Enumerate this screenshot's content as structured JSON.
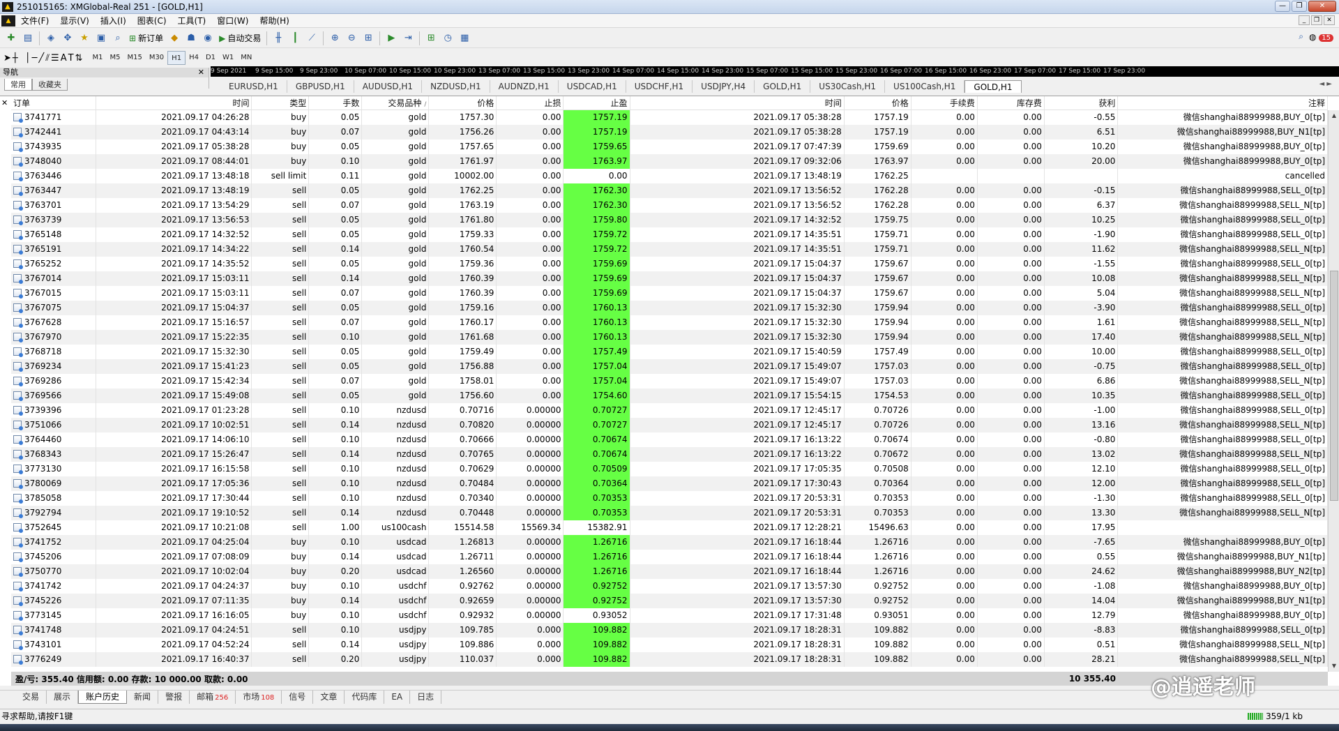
{
  "window": {
    "title": "251015165: XMGlobal-Real 251 - [GOLD,H1]"
  },
  "menu": [
    "文件(F)",
    "显示(V)",
    "插入(I)",
    "图表(C)",
    "工具(T)",
    "窗口(W)",
    "帮助(H)"
  ],
  "toolbar": {
    "new_order": "新订单",
    "auto_trade": "自动交易",
    "timeframes": [
      "M1",
      "M5",
      "M15",
      "M30",
      "H1",
      "H4",
      "D1",
      "W1",
      "MN"
    ],
    "notification_count": "15"
  },
  "navigator": {
    "title": "导航",
    "tabs": [
      "常用",
      "收藏夹"
    ]
  },
  "chart_axis": [
    "9 Sep 2021",
    "9 Sep 15:00",
    "9 Sep 23:00",
    "10 Sep 07:00",
    "10 Sep 15:00",
    "10 Sep 23:00",
    "13 Sep 07:00",
    "13 Sep 15:00",
    "13 Sep 23:00",
    "14 Sep 07:00",
    "14 Sep 15:00",
    "14 Sep 23:00",
    "15 Sep 07:00",
    "15 Sep 15:00",
    "15 Sep 23:00",
    "16 Sep 07:00",
    "16 Sep 15:00",
    "16 Sep 23:00",
    "17 Sep 07:00",
    "17 Sep 15:00",
    "17 Sep 23:00"
  ],
  "chart_tabs": [
    "EURUSD,H1",
    "GBPUSD,H1",
    "AUDUSD,H1",
    "NZDUSD,H1",
    "AUDNZD,H1",
    "USDCAD,H1",
    "USDCHF,H1",
    "USDJPY,H4",
    "GOLD,H1",
    "US30Cash,H1",
    "US100Cash,H1",
    "GOLD,H1"
  ],
  "columns": [
    "订单",
    "时间",
    "类型",
    "手数",
    "交易品种",
    "价格",
    "止损",
    "止盈",
    "时间",
    "价格",
    "手续费",
    "库存费",
    "获利",
    "注释"
  ],
  "rows": [
    [
      "3741771",
      "2021.09.17 04:26:28",
      "buy",
      "0.05",
      "gold",
      "1757.30",
      "0.00",
      "1757.19",
      "2021.09.17 05:38:28",
      "1757.19",
      "0.00",
      "0.00",
      "-0.55",
      "微信shanghai88999988,BUY_0[tp]",
      "g"
    ],
    [
      "3742441",
      "2021.09.17 04:43:14",
      "buy",
      "0.07",
      "gold",
      "1756.26",
      "0.00",
      "1757.19",
      "2021.09.17 05:38:28",
      "1757.19",
      "0.00",
      "0.00",
      "6.51",
      "微信shanghai88999988,BUY_N1[tp]",
      "g"
    ],
    [
      "3743935",
      "2021.09.17 05:38:28",
      "buy",
      "0.05",
      "gold",
      "1757.65",
      "0.00",
      "1759.65",
      "2021.09.17 07:47:39",
      "1759.69",
      "0.00",
      "0.00",
      "10.20",
      "微信shanghai88999988,BUY_0[tp]",
      "g"
    ],
    [
      "3748040",
      "2021.09.17 08:44:01",
      "buy",
      "0.10",
      "gold",
      "1761.97",
      "0.00",
      "1763.97",
      "2021.09.17 09:32:06",
      "1763.97",
      "0.00",
      "0.00",
      "20.00",
      "微信shanghai88999988,BUY_0[tp]",
      "g"
    ],
    [
      "3763446",
      "2021.09.17 13:48:18",
      "sell limit",
      "0.11",
      "gold",
      "10002.00",
      "0.00",
      "0.00",
      "2021.09.17 13:48:19",
      "1762.25",
      "",
      "",
      "",
      "cancelled",
      ""
    ],
    [
      "3763447",
      "2021.09.17 13:48:19",
      "sell",
      "0.05",
      "gold",
      "1762.25",
      "0.00",
      "1762.30",
      "2021.09.17 13:56:52",
      "1762.28",
      "0.00",
      "0.00",
      "-0.15",
      "微信shanghai88999988,SELL_0[tp]",
      "g"
    ],
    [
      "3763701",
      "2021.09.17 13:54:29",
      "sell",
      "0.07",
      "gold",
      "1763.19",
      "0.00",
      "1762.30",
      "2021.09.17 13:56:52",
      "1762.28",
      "0.00",
      "0.00",
      "6.37",
      "微信shanghai88999988,SELL_N[tp]",
      "g"
    ],
    [
      "3763739",
      "2021.09.17 13:56:53",
      "sell",
      "0.05",
      "gold",
      "1761.80",
      "0.00",
      "1759.80",
      "2021.09.17 14:32:52",
      "1759.75",
      "0.00",
      "0.00",
      "10.25",
      "微信shanghai88999988,SELL_0[tp]",
      "g"
    ],
    [
      "3765148",
      "2021.09.17 14:32:52",
      "sell",
      "0.05",
      "gold",
      "1759.33",
      "0.00",
      "1759.72",
      "2021.09.17 14:35:51",
      "1759.71",
      "0.00",
      "0.00",
      "-1.90",
      "微信shanghai88999988,SELL_0[tp]",
      "g"
    ],
    [
      "3765191",
      "2021.09.17 14:34:22",
      "sell",
      "0.14",
      "gold",
      "1760.54",
      "0.00",
      "1759.72",
      "2021.09.17 14:35:51",
      "1759.71",
      "0.00",
      "0.00",
      "11.62",
      "微信shanghai88999988,SELL_N[tp]",
      "g"
    ],
    [
      "3765252",
      "2021.09.17 14:35:52",
      "sell",
      "0.05",
      "gold",
      "1759.36",
      "0.00",
      "1759.69",
      "2021.09.17 15:04:37",
      "1759.67",
      "0.00",
      "0.00",
      "-1.55",
      "微信shanghai88999988,SELL_0[tp]",
      "g"
    ],
    [
      "3767014",
      "2021.09.17 15:03:11",
      "sell",
      "0.14",
      "gold",
      "1760.39",
      "0.00",
      "1759.69",
      "2021.09.17 15:04:37",
      "1759.67",
      "0.00",
      "0.00",
      "10.08",
      "微信shanghai88999988,SELL_N[tp]",
      "g"
    ],
    [
      "3767015",
      "2021.09.17 15:03:11",
      "sell",
      "0.07",
      "gold",
      "1760.39",
      "0.00",
      "1759.69",
      "2021.09.17 15:04:37",
      "1759.67",
      "0.00",
      "0.00",
      "5.04",
      "微信shanghai88999988,SELL_N[tp]",
      "g"
    ],
    [
      "3767075",
      "2021.09.17 15:04:37",
      "sell",
      "0.05",
      "gold",
      "1759.16",
      "0.00",
      "1760.13",
      "2021.09.17 15:32:30",
      "1759.94",
      "0.00",
      "0.00",
      "-3.90",
      "微信shanghai88999988,SELL_0[tp]",
      "g"
    ],
    [
      "3767628",
      "2021.09.17 15:16:57",
      "sell",
      "0.07",
      "gold",
      "1760.17",
      "0.00",
      "1760.13",
      "2021.09.17 15:32:30",
      "1759.94",
      "0.00",
      "0.00",
      "1.61",
      "微信shanghai88999988,SELL_N[tp]",
      "g"
    ],
    [
      "3767970",
      "2021.09.17 15:22:35",
      "sell",
      "0.10",
      "gold",
      "1761.68",
      "0.00",
      "1760.13",
      "2021.09.17 15:32:30",
      "1759.94",
      "0.00",
      "0.00",
      "17.40",
      "微信shanghai88999988,SELL_N[tp]",
      "g"
    ],
    [
      "3768718",
      "2021.09.17 15:32:30",
      "sell",
      "0.05",
      "gold",
      "1759.49",
      "0.00",
      "1757.49",
      "2021.09.17 15:40:59",
      "1757.49",
      "0.00",
      "0.00",
      "10.00",
      "微信shanghai88999988,SELL_0[tp]",
      "g"
    ],
    [
      "3769234",
      "2021.09.17 15:41:23",
      "sell",
      "0.05",
      "gold",
      "1756.88",
      "0.00",
      "1757.04",
      "2021.09.17 15:49:07",
      "1757.03",
      "0.00",
      "0.00",
      "-0.75",
      "微信shanghai88999988,SELL_0[tp]",
      "g"
    ],
    [
      "3769286",
      "2021.09.17 15:42:34",
      "sell",
      "0.07",
      "gold",
      "1758.01",
      "0.00",
      "1757.04",
      "2021.09.17 15:49:07",
      "1757.03",
      "0.00",
      "0.00",
      "6.86",
      "微信shanghai88999988,SELL_N[tp]",
      "g"
    ],
    [
      "3769566",
      "2021.09.17 15:49:08",
      "sell",
      "0.05",
      "gold",
      "1756.60",
      "0.00",
      "1754.60",
      "2021.09.17 15:54:15",
      "1754.53",
      "0.00",
      "0.00",
      "10.35",
      "微信shanghai88999988,SELL_0[tp]",
      "g"
    ],
    [
      "3739396",
      "2021.09.17 01:23:28",
      "sell",
      "0.10",
      "nzdusd",
      "0.70716",
      "0.00000",
      "0.70727",
      "2021.09.17 12:45:17",
      "0.70726",
      "0.00",
      "0.00",
      "-1.00",
      "微信shanghai88999988,SELL_0[tp]",
      "g"
    ],
    [
      "3751066",
      "2021.09.17 10:02:51",
      "sell",
      "0.14",
      "nzdusd",
      "0.70820",
      "0.00000",
      "0.70727",
      "2021.09.17 12:45:17",
      "0.70726",
      "0.00",
      "0.00",
      "13.16",
      "微信shanghai88999988,SELL_N[tp]",
      "g"
    ],
    [
      "3764460",
      "2021.09.17 14:06:10",
      "sell",
      "0.10",
      "nzdusd",
      "0.70666",
      "0.00000",
      "0.70674",
      "2021.09.17 16:13:22",
      "0.70674",
      "0.00",
      "0.00",
      "-0.80",
      "微信shanghai88999988,SELL_0[tp]",
      "g"
    ],
    [
      "3768343",
      "2021.09.17 15:26:47",
      "sell",
      "0.14",
      "nzdusd",
      "0.70765",
      "0.00000",
      "0.70674",
      "2021.09.17 16:13:22",
      "0.70672",
      "0.00",
      "0.00",
      "13.02",
      "微信shanghai88999988,SELL_N[tp]",
      "g"
    ],
    [
      "3773130",
      "2021.09.17 16:15:58",
      "sell",
      "0.10",
      "nzdusd",
      "0.70629",
      "0.00000",
      "0.70509",
      "2021.09.17 17:05:35",
      "0.70508",
      "0.00",
      "0.00",
      "12.10",
      "微信shanghai88999988,SELL_0[tp]",
      "g"
    ],
    [
      "3780069",
      "2021.09.17 17:05:36",
      "sell",
      "0.10",
      "nzdusd",
      "0.70484",
      "0.00000",
      "0.70364",
      "2021.09.17 17:30:43",
      "0.70364",
      "0.00",
      "0.00",
      "12.00",
      "微信shanghai88999988,SELL_0[tp]",
      "g"
    ],
    [
      "3785058",
      "2021.09.17 17:30:44",
      "sell",
      "0.10",
      "nzdusd",
      "0.70340",
      "0.00000",
      "0.70353",
      "2021.09.17 20:53:31",
      "0.70353",
      "0.00",
      "0.00",
      "-1.30",
      "微信shanghai88999988,SELL_0[tp]",
      "g"
    ],
    [
      "3792794",
      "2021.09.17 19:10:52",
      "sell",
      "0.14",
      "nzdusd",
      "0.70448",
      "0.00000",
      "0.70353",
      "2021.09.17 20:53:31",
      "0.70353",
      "0.00",
      "0.00",
      "13.30",
      "微信shanghai88999988,SELL_N[tp]",
      "g"
    ],
    [
      "3752645",
      "2021.09.17 10:21:08",
      "sell",
      "1.00",
      "us100cash",
      "15514.58",
      "15569.34",
      "15382.91",
      "2021.09.17 12:28:21",
      "15496.63",
      "0.00",
      "0.00",
      "17.95",
      "",
      ""
    ],
    [
      "3741752",
      "2021.09.17 04:25:04",
      "buy",
      "0.10",
      "usdcad",
      "1.26813",
      "0.00000",
      "1.26716",
      "2021.09.17 16:18:44",
      "1.26716",
      "0.00",
      "0.00",
      "-7.65",
      "微信shanghai88999988,BUY_0[tp]",
      "g"
    ],
    [
      "3745206",
      "2021.09.17 07:08:09",
      "buy",
      "0.14",
      "usdcad",
      "1.26711",
      "0.00000",
      "1.26716",
      "2021.09.17 16:18:44",
      "1.26716",
      "0.00",
      "0.00",
      "0.55",
      "微信shanghai88999988,BUY_N1[tp]",
      "g"
    ],
    [
      "3750770",
      "2021.09.17 10:02:04",
      "buy",
      "0.20",
      "usdcad",
      "1.26560",
      "0.00000",
      "1.26716",
      "2021.09.17 16:18:44",
      "1.26716",
      "0.00",
      "0.00",
      "24.62",
      "微信shanghai88999988,BUY_N2[tp]",
      "g"
    ],
    [
      "3741742",
      "2021.09.17 04:24:37",
      "buy",
      "0.10",
      "usdchf",
      "0.92762",
      "0.00000",
      "0.92752",
      "2021.09.17 13:57:30",
      "0.92752",
      "0.00",
      "0.00",
      "-1.08",
      "微信shanghai88999988,BUY_0[tp]",
      "g"
    ],
    [
      "3745226",
      "2021.09.17 07:11:35",
      "buy",
      "0.14",
      "usdchf",
      "0.92659",
      "0.00000",
      "0.92752",
      "2021.09.17 13:57:30",
      "0.92752",
      "0.00",
      "0.00",
      "14.04",
      "微信shanghai88999988,BUY_N1[tp]",
      "g"
    ],
    [
      "3773145",
      "2021.09.17 16:16:05",
      "buy",
      "0.10",
      "usdchf",
      "0.92932",
      "0.00000",
      "0.93052",
      "2021.09.17 17:31:48",
      "0.93051",
      "0.00",
      "0.00",
      "12.79",
      "微信shanghai88999988,BUY_0[tp]",
      ""
    ],
    [
      "3741748",
      "2021.09.17 04:24:51",
      "sell",
      "0.10",
      "usdjpy",
      "109.785",
      "0.000",
      "109.882",
      "2021.09.17 18:28:31",
      "109.882",
      "0.00",
      "0.00",
      "-8.83",
      "微信shanghai88999988,SELL_0[tp]",
      "g"
    ],
    [
      "3743101",
      "2021.09.17 04:52:24",
      "sell",
      "0.14",
      "usdjpy",
      "109.886",
      "0.000",
      "109.882",
      "2021.09.17 18:28:31",
      "109.882",
      "0.00",
      "0.00",
      "0.51",
      "微信shanghai88999988,SELL_N[tp]",
      "g"
    ],
    [
      "3776249",
      "2021.09.17 16:40:37",
      "sell",
      "0.20",
      "usdjpy",
      "110.037",
      "0.000",
      "109.882",
      "2021.09.17 18:28:31",
      "109.882",
      "0.00",
      "0.00",
      "28.21",
      "微信shanghai88999988,SELL_N[tp]",
      "g"
    ]
  ],
  "summary": {
    "text": "盈/亏: 355.40  信用额: 0.00  存款: 10 000.00  取款: 0.00",
    "total": "10 355.40"
  },
  "terminal_tabs": [
    {
      "label": "交易",
      "count": ""
    },
    {
      "label": "展示",
      "count": ""
    },
    {
      "label": "账户历史",
      "count": ""
    },
    {
      "label": "新闻",
      "count": ""
    },
    {
      "label": "警报",
      "count": ""
    },
    {
      "label": "邮箱",
      "count": "256"
    },
    {
      "label": "市场",
      "count": "108"
    },
    {
      "label": "信号",
      "count": ""
    },
    {
      "label": "文章",
      "count": ""
    },
    {
      "label": "代码库",
      "count": ""
    },
    {
      "label": "EA",
      "count": ""
    },
    {
      "label": "日志",
      "count": ""
    }
  ],
  "watermark": "@逍遥老师",
  "status": {
    "help": "寻求帮助,请按F1键",
    "traffic": "359/1 kb"
  },
  "colors": {
    "tp_highlight": "#66ff44"
  }
}
